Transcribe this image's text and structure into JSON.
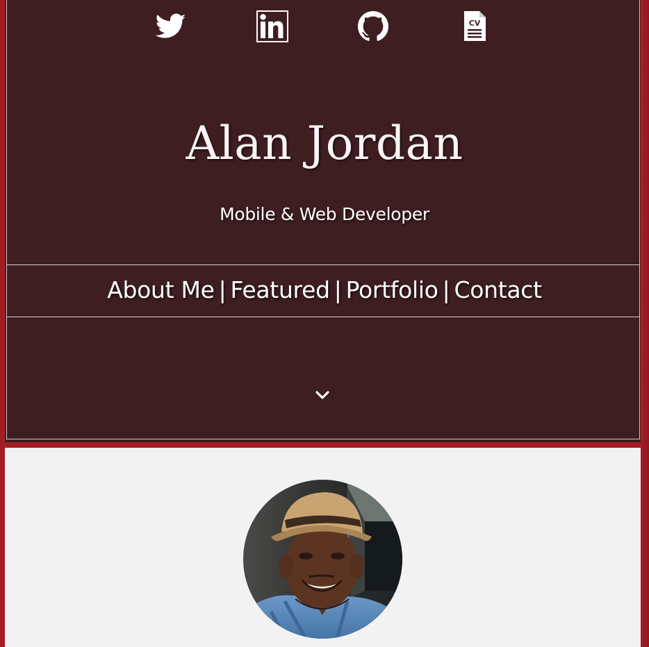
{
  "social": [
    {
      "name": "twitter",
      "icon": "twitter-icon"
    },
    {
      "name": "linkedin",
      "icon": "linkedin-icon"
    },
    {
      "name": "github",
      "icon": "github-icon"
    },
    {
      "name": "resume",
      "icon": "cv-document-icon",
      "label": "CV"
    }
  ],
  "hero": {
    "name": "Alan Jordan",
    "tagline": "Mobile & Web Developer"
  },
  "nav": {
    "items": [
      "About Me",
      "Featured",
      "Portfolio",
      "Contact"
    ],
    "separator": "|"
  },
  "scroll_icon": "chevron-down-icon",
  "colors": {
    "hero_bg": "#3f1e21",
    "frame_accent": "#a31c24",
    "about_bg": "#f2f2f2",
    "text_light": "#ffffff"
  }
}
